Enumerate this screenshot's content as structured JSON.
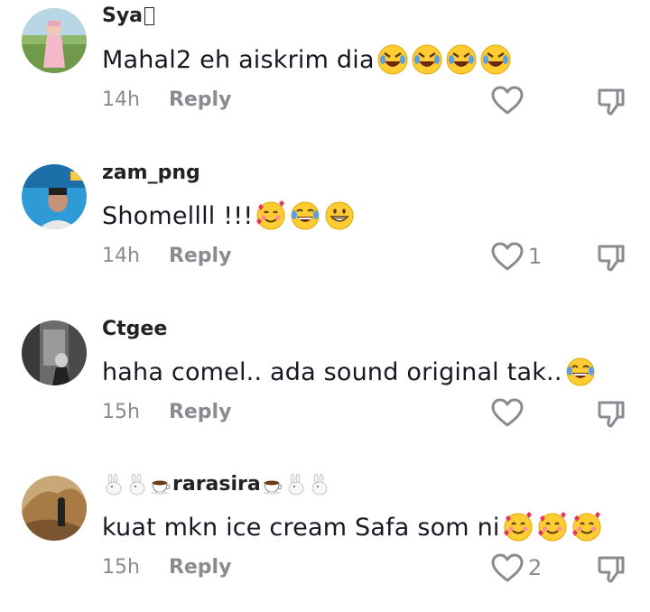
{
  "comments": [
    {
      "username": "Sya",
      "text": "Mahal2 eh aiskrim dia",
      "text_emojis": [
        "rofl-emoji",
        "rofl-emoji",
        "rofl-emoji",
        "rofl-emoji"
      ],
      "time": "14h",
      "reply_label": "Reply",
      "like_count": ""
    },
    {
      "username": "zam_png",
      "text": "Shomellll !!! ",
      "text_emojis": [
        "smiling-face-with-hearts-emoji",
        "joy-emoji",
        "grin-emoji"
      ],
      "time": "14h",
      "reply_label": "Reply",
      "like_count": "1"
    },
    {
      "username": "Ctgee",
      "text": "haha comel.. ada sound original tak..",
      "text_emojis": [
        "joy-emoji"
      ],
      "time": "15h",
      "reply_label": "Reply",
      "like_count": ""
    },
    {
      "username": "rarasira",
      "text": "kuat mkn ice cream Safa som ni",
      "text_emojis": [
        "smiling-face-with-hearts-emoji",
        "smiling-face-with-hearts-emoji",
        "smiling-face-with-hearts-emoji"
      ],
      "time": "15h",
      "reply_label": "Reply",
      "like_count": "2"
    }
  ],
  "colors": {
    "text": "#161823",
    "muted": "#8a8b91",
    "emoji_yellow": "#ffcc33"
  }
}
